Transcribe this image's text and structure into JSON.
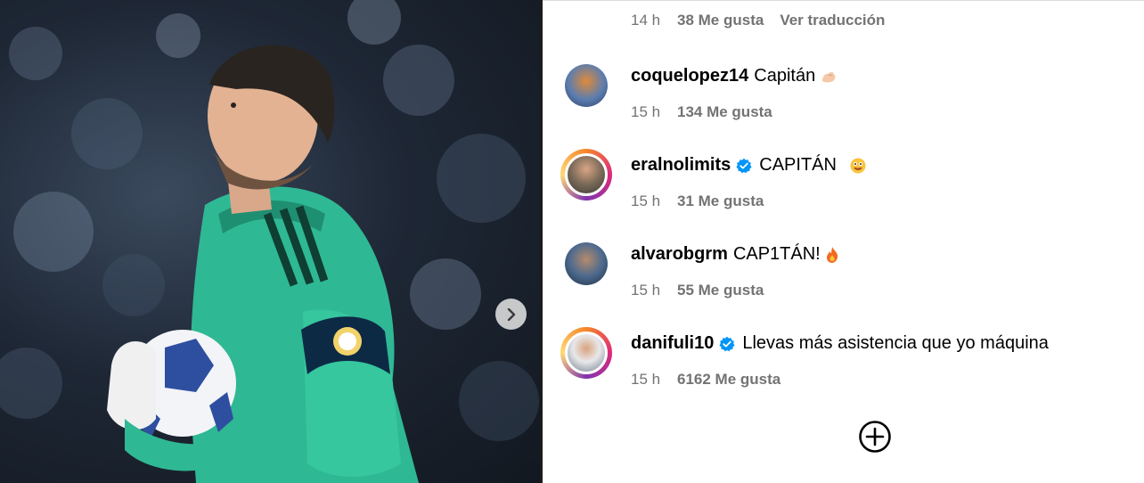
{
  "photo": {
    "alt_icon": "goalkeeper-photo",
    "next_icon": "chevron-right-icon"
  },
  "top_meta": {
    "time": "14 h",
    "likes": "38 Me gusta",
    "translate": "Ver traducción"
  },
  "comments": [
    {
      "username": "coquelopez14",
      "verified": false,
      "story_ring": false,
      "text": "Capitán",
      "emoji": "flexed-biceps-icon",
      "time": "15 h",
      "likes": "134 Me gusta"
    },
    {
      "username": "eralnolimits",
      "verified": true,
      "story_ring": true,
      "text": "CAPITÁN",
      "emoji": "smiling-face-icon",
      "time": "15 h",
      "likes": "31 Me gusta"
    },
    {
      "username": "alvarobgrm",
      "verified": false,
      "story_ring": false,
      "text": "CAP1TÁN!",
      "emoji": "fire-icon",
      "time": "15 h",
      "likes": "55 Me gusta"
    },
    {
      "username": "danifuli10",
      "verified": true,
      "story_ring": true,
      "text": "Llevas más asistencia que yo máquina",
      "emoji": "",
      "time": "15 h",
      "likes": "6162 Me gusta"
    }
  ],
  "load_more_icon": "plus-circle-icon",
  "colors": {
    "text": "#000000",
    "secondary": "#737373",
    "verified_blue": "#0095f6",
    "divider": "#1b1b1b"
  }
}
